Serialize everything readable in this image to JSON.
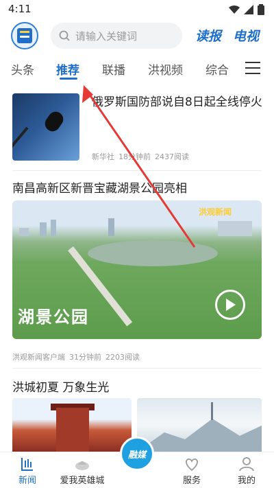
{
  "status_bar": {
    "time": "4:11"
  },
  "header": {
    "search_placeholder": "请输入关键词",
    "read_label": "读报",
    "tv_label": "电视"
  },
  "channels": {
    "tabs": [
      {
        "label": "头条"
      },
      {
        "label": "推荐",
        "active": true
      },
      {
        "label": "联播"
      },
      {
        "label": "洪视频"
      },
      {
        "label": "综合"
      }
    ]
  },
  "feed": {
    "article1": {
      "title": "俄罗斯国防部说自8日起全线停火",
      "source": "新华社",
      "time": "18分钟前",
      "reads": "2437阅读"
    },
    "article2": {
      "title": "南昌高新区新晋宝藏湖景公园亮相",
      "video_caption": "湖景公园",
      "video_watermark": "洪观新闻",
      "source": "洪观新闻客户端",
      "time": "31分钟前",
      "reads": "2203阅读"
    },
    "article3": {
      "title": "洪城初夏 万象生光"
    }
  },
  "bottom_nav": {
    "items": [
      {
        "label": "新闻",
        "active": true
      },
      {
        "label": "爱我英雄城"
      },
      {
        "label": ""
      },
      {
        "label": "服务"
      },
      {
        "label": "我的"
      }
    ],
    "center_label": "融媒"
  },
  "colors": {
    "accent": "#1e6fc9",
    "annotation_arrow": "#e53935"
  }
}
